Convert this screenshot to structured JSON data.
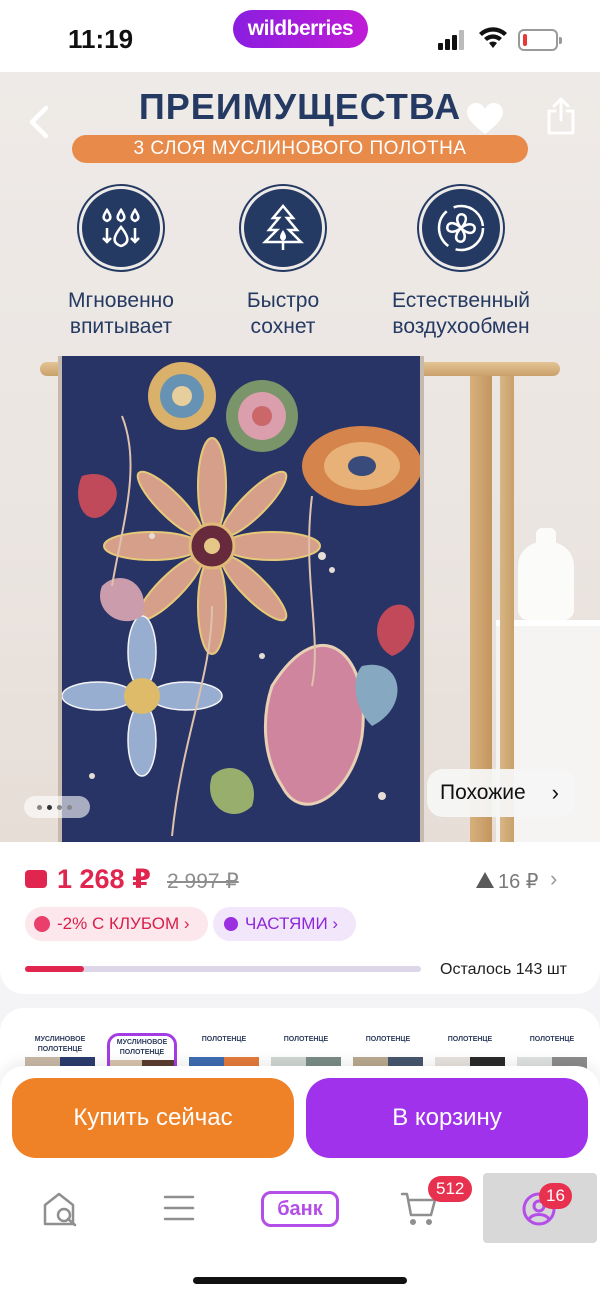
{
  "status_bar": {
    "time": "11:19",
    "brand": "wildberries"
  },
  "hero": {
    "title": "ПРЕИМУЩЕСТВА",
    "subtitle": "3 СЛОЯ МУСЛИНОВОГО ПОЛОТНА",
    "features": [
      {
        "line1": "Мгновенно",
        "line2": "впитывает",
        "icon": "water-drops-icon"
      },
      {
        "line1": "Быстро",
        "line2": "сохнет",
        "icon": "tree-drop-icon"
      },
      {
        "line1": "Естественный",
        "line2": "воздухообмен",
        "icon": "airflow-icon"
      }
    ],
    "similar_label": "Похожие",
    "gallery_dots": 4,
    "gallery_active": 0
  },
  "price": {
    "current": "1 268 ₽",
    "old": "2 997 ₽",
    "delta": "16 ₽",
    "club_label": "-2% С КЛУБОМ",
    "parts_label": "ЧАСТЯМИ",
    "stock_text": "Осталось 143 шт",
    "stock_fraction": 0.15
  },
  "variants": [
    {
      "head": "МУСЛИНОВОЕ ПОЛОТЕНЦЕ",
      "colors": [
        "#c9b8a6",
        "#2b3c6e"
      ]
    },
    {
      "head": "МУСЛИНОВОЕ ПОЛОТЕНЦЕ",
      "colors": [
        "#d7c4ad",
        "#5a3d30"
      ],
      "selected": true
    },
    {
      "head": "ПОЛОТЕНЦЕ",
      "colors": [
        "#3d6cb0",
        "#e57a3c"
      ]
    },
    {
      "head": "ПОЛОТЕНЦЕ",
      "colors": [
        "#cfd6d2",
        "#7a8c86"
      ]
    },
    {
      "head": "ПОЛОТЕНЦЕ",
      "colors": [
        "#b9a98f",
        "#46566d"
      ]
    },
    {
      "head": "ПОЛОТЕНЦЕ",
      "colors": [
        "#e7e2de",
        "#2a2a2a"
      ]
    },
    {
      "head": "ПОЛОТЕНЦЕ",
      "colors": [
        "#dfe2e0",
        "#8c8c8c"
      ]
    }
  ],
  "actions": {
    "buy_now": "Купить сейчас",
    "add_to_cart": "В корзину"
  },
  "tabbar": {
    "bank_label": "банк",
    "cart_badge": "512",
    "profile_badge": "16"
  },
  "colors": {
    "accent": "#a032ec",
    "buy": "#ef8127",
    "price": "#e0264f",
    "navy": "#243a63"
  }
}
